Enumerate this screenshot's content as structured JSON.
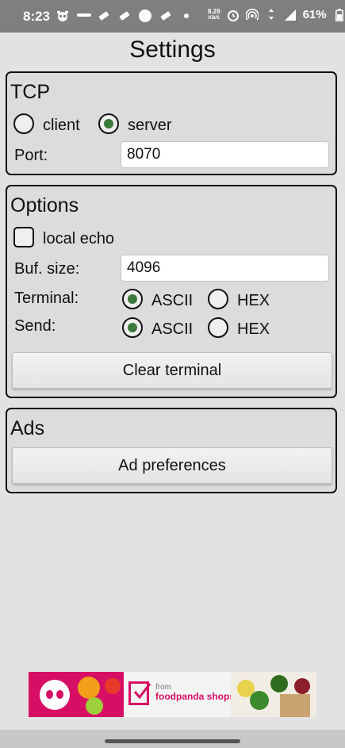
{
  "status_bar": {
    "time": "8:23",
    "net_speed_value": "8.29",
    "net_speed_unit": "KB/S",
    "battery": "61%"
  },
  "page": {
    "title": "Settings"
  },
  "tcp": {
    "title": "TCP",
    "mode_client": "client",
    "mode_server": "server",
    "selected_mode": "server",
    "port_label": "Port:",
    "port_value": "8070"
  },
  "options": {
    "title": "Options",
    "local_echo_label": "local echo",
    "local_echo_checked": false,
    "buf_size_label": "Buf. size:",
    "buf_size_value": "4096",
    "terminal_label": "Terminal:",
    "send_label": "Send:",
    "ascii_label": "ASCII",
    "hex_label": "HEX",
    "terminal_selected": "ASCII",
    "send_selected": "ASCII",
    "clear_button": "Clear terminal"
  },
  "ads": {
    "title": "Ads",
    "preferences_button": "Ad preferences"
  },
  "banner": {
    "from_text": "from",
    "brand_text": "foodpanda shops",
    "brand_color": "#d70f64"
  },
  "colors": {
    "radio_selected": "#3a7a3a",
    "status_bar": "#7f7f7f"
  }
}
